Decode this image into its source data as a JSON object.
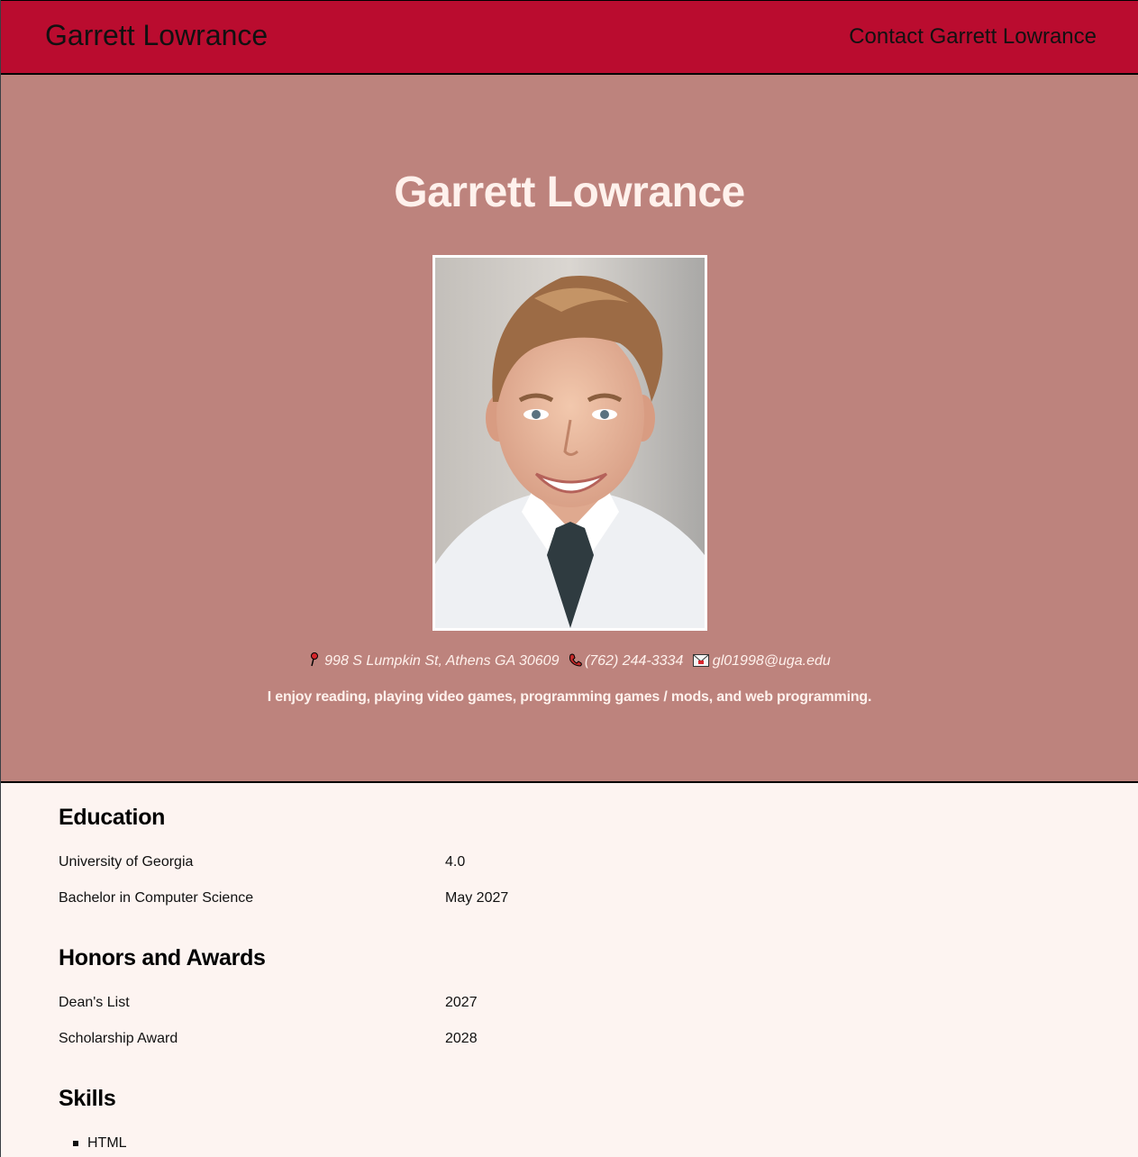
{
  "nav": {
    "brand": "Garrett Lowrance",
    "contact": "Contact Garrett Lowrance"
  },
  "hero": {
    "title": "Garrett Lowrance",
    "address": "998 S Lumpkin St, Athens GA 30609",
    "phone": "(762) 244-3334",
    "email": "gl01998@uga.edu",
    "bio": "I enjoy reading, playing video games, programming games / mods, and web programming."
  },
  "education": {
    "heading": "Education",
    "rows": [
      {
        "label": "University of Georgia",
        "value": "4.0"
      },
      {
        "label": "Bachelor in Computer Science",
        "value": "May 2027"
      }
    ]
  },
  "honors": {
    "heading": "Honors and Awards",
    "rows": [
      {
        "label": "Dean's List",
        "value": "2027"
      },
      {
        "label": "Scholarship Award",
        "value": "2028"
      }
    ]
  },
  "skills": {
    "heading": "Skills",
    "items": [
      "HTML"
    ]
  },
  "icons": {
    "address": "map-pin-icon",
    "phone": "phone-icon",
    "email": "envelope-icon"
  },
  "colors": {
    "navbar": "#ba0c2f",
    "hero_bg": "#bd837d",
    "hero_text": "#fff1ec",
    "content_bg": "#fdf4f1"
  }
}
